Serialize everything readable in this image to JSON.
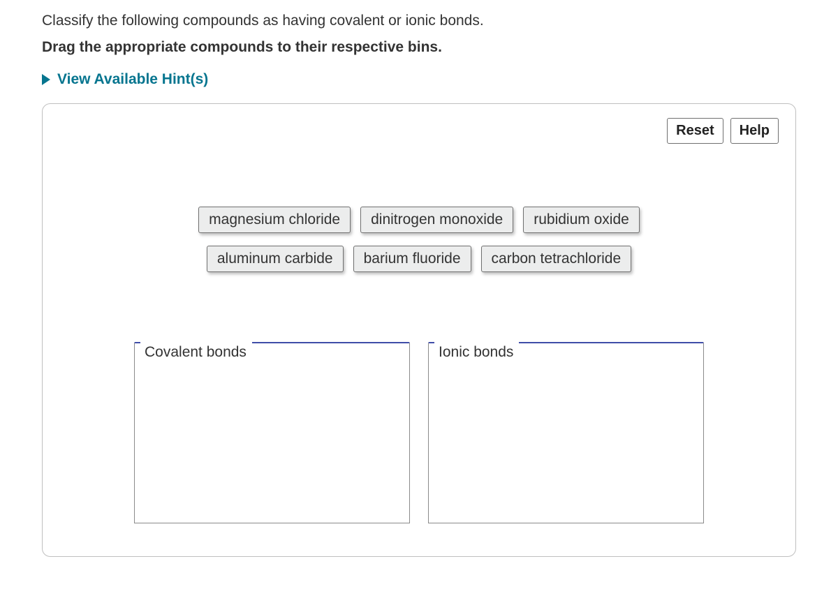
{
  "question": "Classify the following compounds as having covalent or ionic bonds.",
  "instruction": "Drag the appropriate compounds to their respective bins.",
  "hints": {
    "label": "View Available Hint(s)"
  },
  "toolbar": {
    "reset": "Reset",
    "help": "Help"
  },
  "items": {
    "row1": [
      "magnesium chloride",
      "dinitrogen monoxide",
      "rubidium oxide"
    ],
    "row2": [
      "aluminum carbide",
      "barium fluoride",
      "carbon tetrachloride"
    ]
  },
  "bins": {
    "covalent": "Covalent bonds",
    "ionic": "Ionic bonds"
  }
}
